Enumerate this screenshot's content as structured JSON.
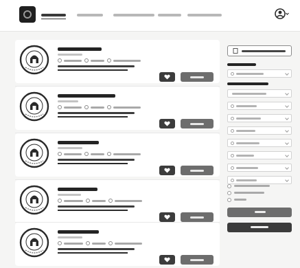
{
  "topbar": {
    "logo_icon": "organization-logo-icon",
    "nav_items": [
      {
        "label": "",
        "active": true
      },
      {
        "label": "",
        "active": false
      },
      {
        "label": "",
        "active": false
      },
      {
        "label": "",
        "active": false
      },
      {
        "label": "",
        "active": false
      }
    ],
    "user_icon": "user-avatar-icon"
  },
  "cards": [
    {
      "title": "",
      "subtitle": "",
      "location": "",
      "type": "",
      "salary": "",
      "match": "",
      "favorite_icon": "heart-icon",
      "apply_label": ""
    },
    {
      "title": "",
      "subtitle": "",
      "location": "",
      "type": "",
      "salary": "",
      "match": "",
      "favorite_icon": "heart-icon",
      "apply_label": ""
    },
    {
      "title": "",
      "subtitle": "",
      "location": "",
      "type": "",
      "salary": "",
      "match": "",
      "favorite_icon": "heart-icon",
      "apply_label": ""
    },
    {
      "title": "",
      "subtitle": "",
      "location": "",
      "type": "",
      "salary": "",
      "match": "",
      "favorite_icon": "heart-icon",
      "apply_label": ""
    },
    {
      "title": "",
      "subtitle": "",
      "location": "",
      "type": "",
      "salary": "",
      "match": "",
      "favorite_icon": "heart-icon",
      "apply_label": ""
    }
  ],
  "sidebar": {
    "top_button_label": "",
    "sort_heading": "",
    "sort_value": "",
    "filter_heading": "",
    "filters": [
      {
        "value": ""
      },
      {
        "value": ""
      },
      {
        "value": ""
      },
      {
        "value": ""
      },
      {
        "value": ""
      },
      {
        "value": ""
      },
      {
        "value": ""
      },
      {
        "value": ""
      }
    ],
    "radio_options": [
      {
        "label": ""
      },
      {
        "label": ""
      },
      {
        "label": ""
      }
    ],
    "search_button_label": "",
    "reset_button_label": ""
  },
  "colors": {
    "accent": "#3c3c3c",
    "secondary_button": "#6d6d6d",
    "background": "#f5f5f4",
    "card": "#ffffff"
  }
}
